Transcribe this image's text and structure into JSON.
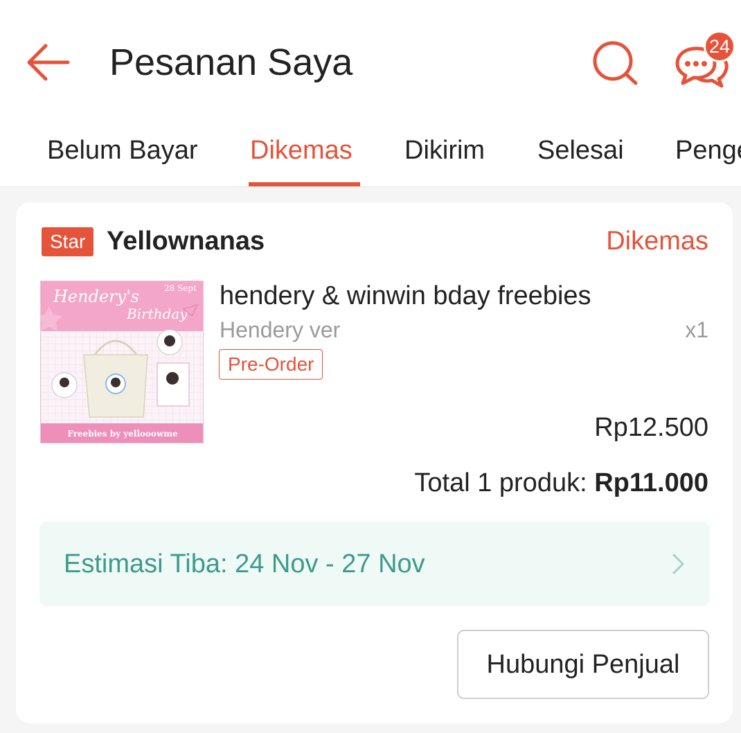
{
  "header": {
    "title": "Pesanan Saya",
    "chat_badge": "24",
    "icons": {
      "back": "arrow-left-icon",
      "search": "search-icon",
      "chat": "chat-icon"
    }
  },
  "tabs": [
    {
      "label": "Belum Bayar",
      "active": false
    },
    {
      "label": "Dikemas",
      "active": true
    },
    {
      "label": "Dikirim",
      "active": false
    },
    {
      "label": "Selesai",
      "active": false
    },
    {
      "label": "Pengembalian",
      "active": false
    }
  ],
  "order": {
    "shop_badge": "Star",
    "shop_name": "Yellownanas",
    "status": "Dikemas",
    "product": {
      "name": "hendery & winwin bday freebies",
      "variant": "Hendery ver",
      "quantity": "x1",
      "tag": "Pre-Order",
      "price": "Rp12.500",
      "image": {
        "title_line1": "Hendery's",
        "title_line2": "Birthday",
        "date": "28 Sept",
        "footer": "Freebies by yellooowme"
      }
    },
    "total_label": "Total 1 produk: ",
    "total_value": "Rp11.000",
    "estimate": "Estimasi Tiba: 24 Nov - 27 Nov",
    "contact_button": "Hubungi Penjual"
  },
  "colors": {
    "accent": "#e4533a",
    "teal": "#3e9a8a",
    "eta_bg": "#effaf7"
  }
}
